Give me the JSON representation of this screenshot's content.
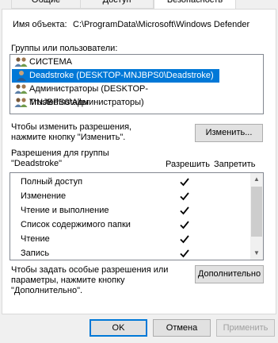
{
  "tabs": [
    {
      "label": "Общие"
    },
    {
      "label": "Доступ"
    },
    {
      "label": "Безопасность"
    }
  ],
  "object": {
    "label": "Имя объекта:",
    "path": "C:\\ProgramData\\Microsoft\\Windows Defender"
  },
  "groups": {
    "label": "Группы или пользователи:",
    "items": [
      {
        "label": "СИСТЕМА",
        "icon": "users-group-icon"
      },
      {
        "label": "Deadstroke (DESKTOP-MNJBPS0\\Deadstroke)",
        "icon": "user-icon",
        "selected": true
      },
      {
        "label": "Администраторы (DESKTOP-MNJBPS0\\Администраторы)",
        "icon": "users-group-icon"
      },
      {
        "label": "TrustedInstaller",
        "icon": "users-group-icon"
      }
    ]
  },
  "change": {
    "hint_line1": "Чтобы изменить разрешения,",
    "hint_line2": "нажмите кнопку \"Изменить\".",
    "button": "Изменить..."
  },
  "permissions": {
    "group_label_line1": "Разрешения для группы",
    "group_label_line2": "\"Deadstroke\"",
    "allow_header": "Разрешить",
    "deny_header": "Запретить",
    "rows": [
      {
        "name": "Полный доступ",
        "allow": true,
        "deny": false
      },
      {
        "name": "Изменение",
        "allow": true,
        "deny": false
      },
      {
        "name": "Чтение и выполнение",
        "allow": true,
        "deny": false
      },
      {
        "name": "Список содержимого папки",
        "allow": true,
        "deny": false
      },
      {
        "name": "Чтение",
        "allow": true,
        "deny": false
      },
      {
        "name": "Запись",
        "allow": true,
        "deny": false
      }
    ]
  },
  "advanced": {
    "hint_line1": "Чтобы задать особые разрешения или",
    "hint_line2": "параметры, нажмите кнопку",
    "hint_line3": "\"Дополнительно\".",
    "button": "Дополнительно"
  },
  "footer": {
    "ok": "OK",
    "cancel": "Отмена",
    "apply": "Применить"
  },
  "colors": {
    "selection": "#0078d7",
    "check": "#000000"
  }
}
